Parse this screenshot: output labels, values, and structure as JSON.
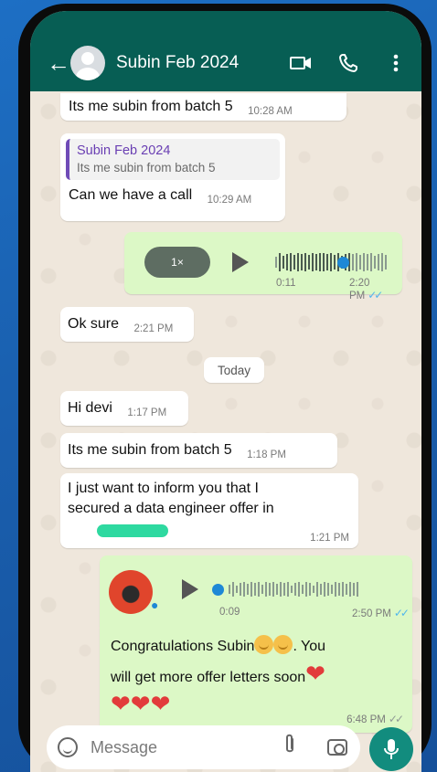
{
  "header": {
    "contact_name": "Subin Feb 2024",
    "icons": [
      "back-arrow-icon",
      "video-call-icon",
      "voice-call-icon",
      "more-menu-icon"
    ]
  },
  "messages": [
    {
      "direction": "incoming",
      "text": "Its me subin from batch 5",
      "time": "10:28 AM"
    },
    {
      "direction": "incoming",
      "quote_name": "Subin Feb 2024",
      "quote_text": "Its me subin from batch 5",
      "text": "Can we have a call",
      "time": "10:29 AM"
    },
    {
      "direction": "outgoing",
      "type": "voice",
      "speed": "1×",
      "duration": "0:11",
      "time": "2:20 PM",
      "status": "read"
    },
    {
      "direction": "incoming",
      "text": "Ok sure",
      "time": "2:21 PM"
    },
    {
      "type": "date",
      "text": "Today"
    },
    {
      "direction": "incoming",
      "text": "Hi devi",
      "time": "1:17 PM"
    },
    {
      "direction": "incoming",
      "text": "Its me subin from batch 5",
      "time": "1:18 PM"
    },
    {
      "direction": "incoming",
      "text_line1": "I just want to inform you that I",
      "text_line2": "secured a data engineer offer  in",
      "time": "1:21 PM"
    },
    {
      "direction": "outgoing",
      "type": "voice",
      "duration": "0:09",
      "time": "2:50 PM",
      "status": "read"
    },
    {
      "direction": "outgoing",
      "text_line1": "Congratulations Subin",
      "text_line1_end": ". You",
      "text_line2": "will get more offer letters soon",
      "time": "6:48 PM",
      "status": "delivered"
    }
  ],
  "input": {
    "placeholder": "Message"
  },
  "colors": {
    "header": "#075e54",
    "outgoing": "#dcf8c6",
    "incoming": "#ffffff",
    "read_ticks": "#4fb6ec",
    "mic": "#128c7e"
  }
}
